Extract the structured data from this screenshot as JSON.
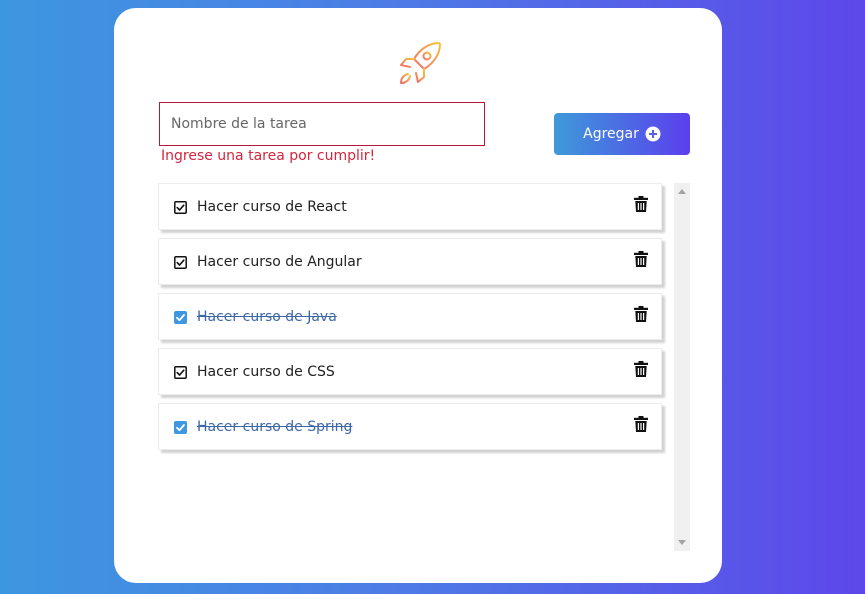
{
  "form": {
    "input_value": "",
    "input_placeholder": "Nombre de la tarea",
    "error_message": "Ingrese una tarea por cumplir!",
    "add_button_label": "Agregar"
  },
  "icons": {
    "logo": "rocket-icon",
    "add": "plus-circle-icon",
    "delete": "trash-icon",
    "unchecked": "square-check-outline-icon",
    "checked": "square-check-filled-icon"
  },
  "colors": {
    "gradient_start": "#3d97e0",
    "gradient_end": "#5d47ea",
    "error": "#d5263f",
    "done_text": "#3d67a6",
    "check_filled": "#3e98e0"
  },
  "tasks": [
    {
      "label": "Hacer curso de React",
      "completed": false
    },
    {
      "label": "Hacer curso de Angular",
      "completed": false
    },
    {
      "label": "Hacer curso de Java",
      "completed": true
    },
    {
      "label": "Hacer curso de CSS",
      "completed": false
    },
    {
      "label": "Hacer curso de Spring",
      "completed": true
    }
  ]
}
